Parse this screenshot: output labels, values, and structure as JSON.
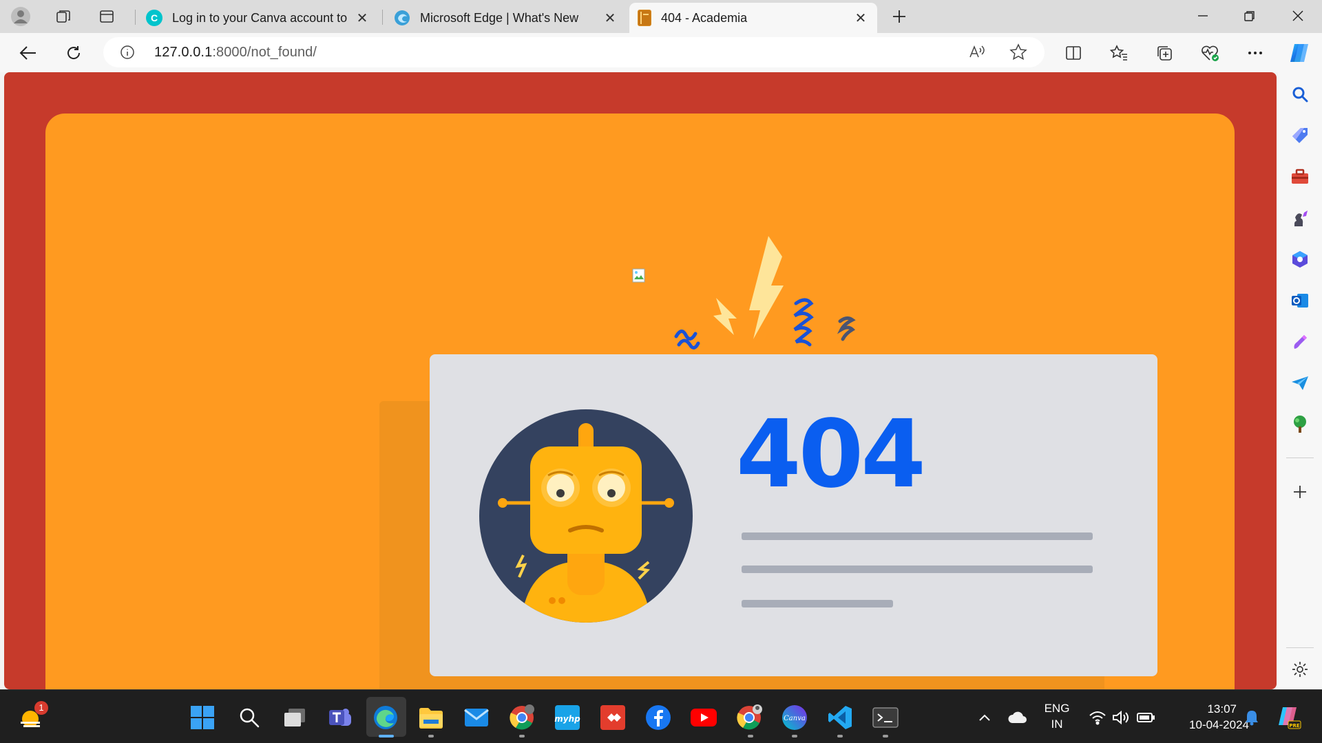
{
  "browser": {
    "tabs": [
      {
        "title": "Log in to your Canva account to",
        "favicon": "canva-icon",
        "active": false
      },
      {
        "title": "Microsoft Edge | What's New",
        "favicon": "edge-icon",
        "active": false
      },
      {
        "title": "404 - Academia",
        "favicon": "book-icon",
        "active": true
      }
    ],
    "address": {
      "host": "127.0.0.1",
      "path": ":8000/not_found/"
    }
  },
  "page": {
    "error_code": "404",
    "colors": {
      "background": "#c63a2b",
      "card": "#ff9a20",
      "panel": "#dfe0e4",
      "code": "#0a5ef0"
    }
  },
  "sidebar_icons": [
    "search-icon",
    "shopping-tag-icon",
    "toolbox-icon",
    "games-icon",
    "m365-icon",
    "outlook-icon",
    "designer-icon",
    "send-icon",
    "tree-icon",
    "add-icon",
    "settings-icon"
  ],
  "taskbar": {
    "weather_badge": "1",
    "language": {
      "line1": "ENG",
      "line2": "IN"
    },
    "time": "13:07",
    "date": "10-04-2024"
  }
}
